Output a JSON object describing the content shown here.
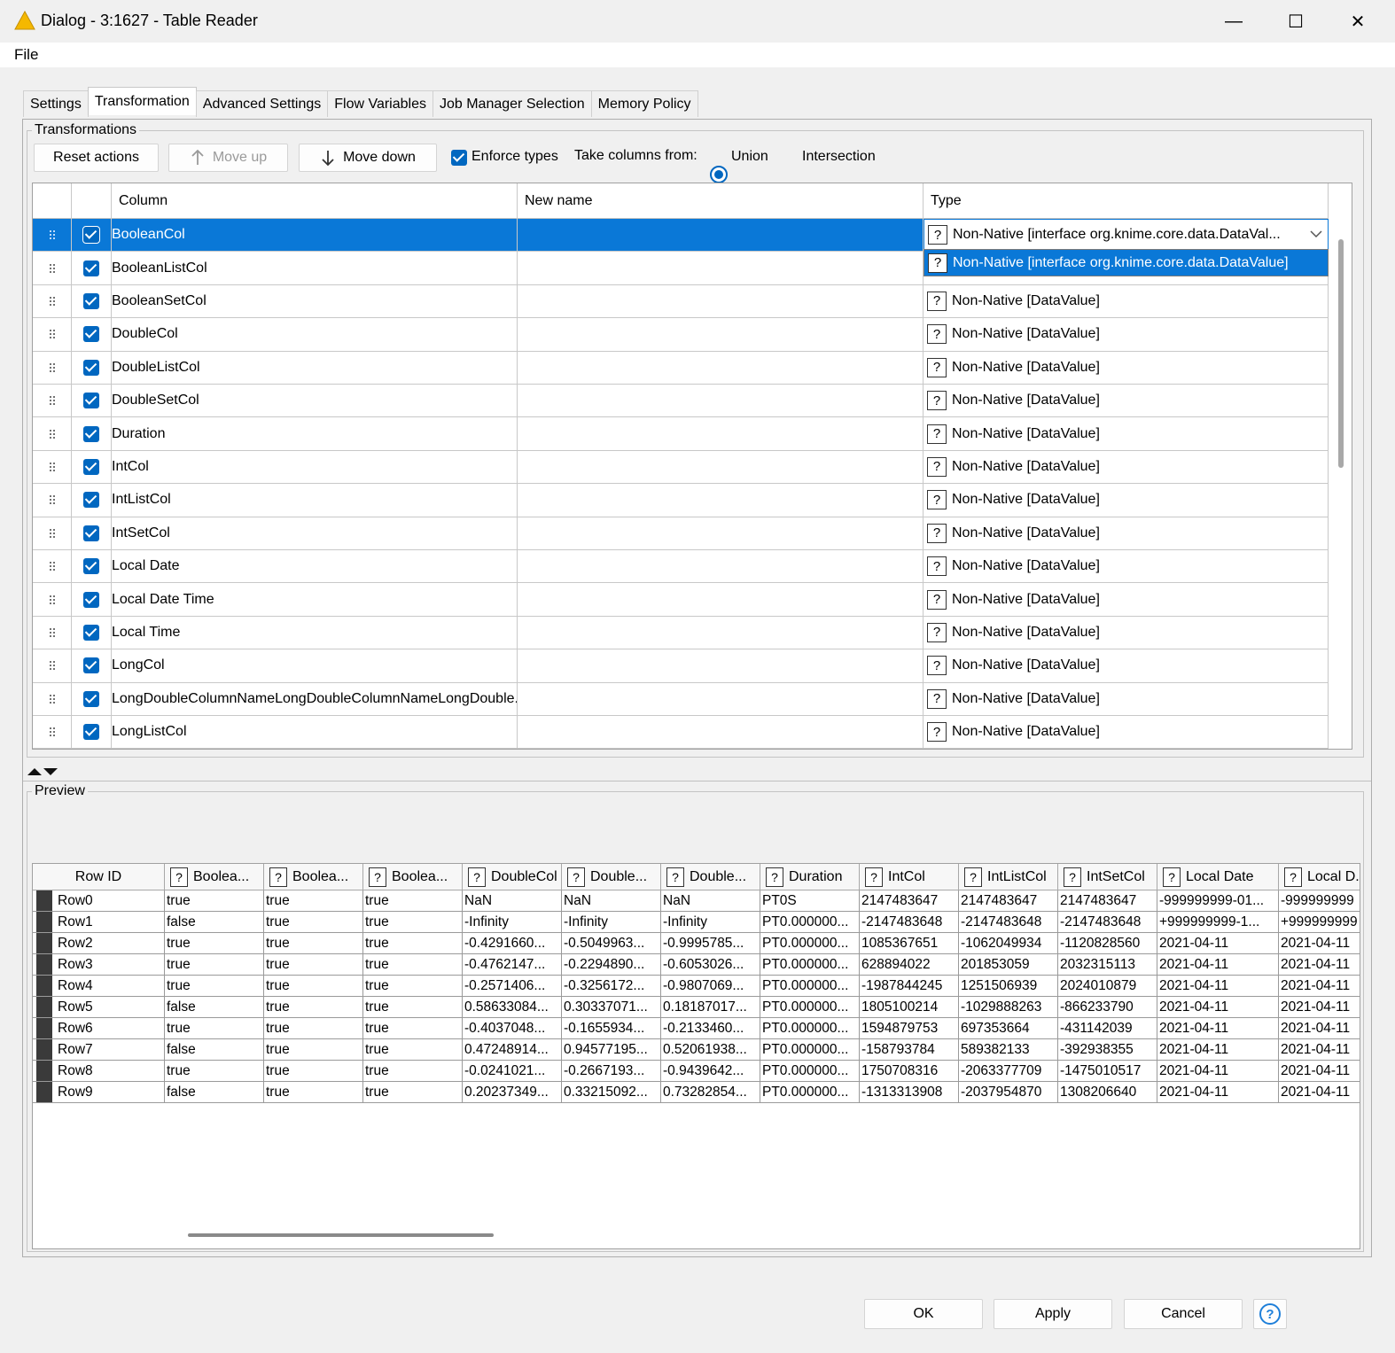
{
  "window": {
    "title": "Dialog - 3:1627 - Table Reader",
    "minimize": "—",
    "maximize": "☐",
    "close": "✕"
  },
  "menu": {
    "file": "File"
  },
  "tabs": [
    {
      "label": "Settings"
    },
    {
      "label": "Transformation"
    },
    {
      "label": "Advanced Settings"
    },
    {
      "label": "Flow Variables"
    },
    {
      "label": "Job Manager Selection"
    },
    {
      "label": "Memory Policy"
    }
  ],
  "transformations": {
    "group_label": "Transformations",
    "reset_label": "Reset actions",
    "move_up_label": "Move up",
    "move_down_label": "Move down",
    "enforce_types_label": "Enforce types",
    "take_columns_label": "Take columns from:",
    "union_label": "Union",
    "intersection_label": "Intersection",
    "headers": {
      "column": "Column",
      "new_name": "New name",
      "type": "Type"
    },
    "selected_type": "Non-Native [interface org.knime.core.data.DataVal...",
    "popup_option": "Non-Native [interface org.knime.core.data.DataValue]",
    "rows": [
      {
        "column": "BooleanCol",
        "new_name": "",
        "type": ""
      },
      {
        "column": "BooleanListCol",
        "new_name": "",
        "type": ""
      },
      {
        "column": "BooleanSetCol",
        "new_name": "",
        "type": "Non-Native [DataValue]"
      },
      {
        "column": "DoubleCol",
        "new_name": "",
        "type": "Non-Native [DataValue]"
      },
      {
        "column": "DoubleListCol",
        "new_name": "",
        "type": "Non-Native [DataValue]"
      },
      {
        "column": "DoubleSetCol",
        "new_name": "",
        "type": "Non-Native [DataValue]"
      },
      {
        "column": "Duration",
        "new_name": "",
        "type": "Non-Native [DataValue]"
      },
      {
        "column": "IntCol",
        "new_name": "",
        "type": "Non-Native [DataValue]"
      },
      {
        "column": "IntListCol",
        "new_name": "",
        "type": "Non-Native [DataValue]"
      },
      {
        "column": "IntSetCol",
        "new_name": "",
        "type": "Non-Native [DataValue]"
      },
      {
        "column": "Local Date",
        "new_name": "",
        "type": "Non-Native [DataValue]"
      },
      {
        "column": "Local Date Time",
        "new_name": "",
        "type": "Non-Native [DataValue]"
      },
      {
        "column": "Local Time",
        "new_name": "",
        "type": "Non-Native [DataValue]"
      },
      {
        "column": "LongCol",
        "new_name": "",
        "type": "Non-Native [DataValue]"
      },
      {
        "column": "LongDoubleColumnNameLongDoubleColumnNameLongDouble...",
        "new_name": "",
        "type": "Non-Native [DataValue]"
      },
      {
        "column": "LongListCol",
        "new_name": "",
        "type": "Non-Native [DataValue]"
      }
    ]
  },
  "preview": {
    "group_label": "Preview",
    "headers": [
      "Row ID",
      "Boolea...",
      "Boolea...",
      "Boolea...",
      "DoubleCol",
      "Double...",
      "Double...",
      "Duration",
      "IntCol",
      "IntListCol",
      "IntSetCol",
      "Local Date",
      "Local D..."
    ],
    "rows": [
      [
        "Row0",
        "true",
        "true",
        "true",
        "NaN",
        "NaN",
        "NaN",
        "PT0S",
        "2147483647",
        "2147483647",
        "2147483647",
        "-999999999-01...",
        "-999999999"
      ],
      [
        "Row1",
        "false",
        "true",
        "true",
        "-Infinity",
        "-Infinity",
        "-Infinity",
        "PT0.000000...",
        "-2147483648",
        "-2147483648",
        "-2147483648",
        "+999999999-1...",
        "+999999999"
      ],
      [
        "Row2",
        "true",
        "true",
        "true",
        "-0.4291660...",
        "-0.5049963...",
        "-0.9995785...",
        "PT0.000000...",
        "1085367651",
        "-1062049934",
        "-1120828560",
        "2021-04-11",
        "2021-04-11"
      ],
      [
        "Row3",
        "true",
        "true",
        "true",
        "-0.4762147...",
        "-0.2294890...",
        "-0.6053026...",
        "PT0.000000...",
        "628894022",
        "201853059",
        "2032315113",
        "2021-04-11",
        "2021-04-11"
      ],
      [
        "Row4",
        "true",
        "true",
        "true",
        "-0.2571406...",
        "-0.3256172...",
        "-0.9807069...",
        "PT0.000000...",
        "-1987844245",
        "1251506939",
        "2024010879",
        "2021-04-11",
        "2021-04-11"
      ],
      [
        "Row5",
        "false",
        "true",
        "true",
        "0.58633084...",
        "0.30337071...",
        "0.18187017...",
        "PT0.000000...",
        "1805100214",
        "-1029888263",
        "-866233790",
        "2021-04-11",
        "2021-04-11"
      ],
      [
        "Row6",
        "true",
        "true",
        "true",
        "-0.4037048...",
        "-0.1655934...",
        "-0.2133460...",
        "PT0.000000...",
        "1594879753",
        "697353664",
        "-431142039",
        "2021-04-11",
        "2021-04-11"
      ],
      [
        "Row7",
        "false",
        "true",
        "true",
        "0.47248914...",
        "0.94577195...",
        "0.52061938...",
        "PT0.000000...",
        "-158793784",
        "589382133",
        "-392938355",
        "2021-04-11",
        "2021-04-11"
      ],
      [
        "Row8",
        "true",
        "true",
        "true",
        "-0.0241021...",
        "-0.2667193...",
        "-0.9439642...",
        "PT0.000000...",
        "1750708316",
        "-2063377709",
        "-1475010517",
        "2021-04-11",
        "2021-04-11"
      ],
      [
        "Row9",
        "false",
        "true",
        "true",
        "0.20237349...",
        "0.33215092...",
        "0.73282854...",
        "PT0.000000...",
        "-1313313908",
        "-2037954870",
        "1308206640",
        "2021-04-11",
        "2021-04-11"
      ]
    ]
  },
  "footer": {
    "ok": "OK",
    "apply": "Apply",
    "cancel": "Cancel",
    "help": "?"
  },
  "icons": {
    "qmark": "?"
  },
  "colors": {
    "selection": "#0a78d7",
    "accent": "#0067c0"
  }
}
